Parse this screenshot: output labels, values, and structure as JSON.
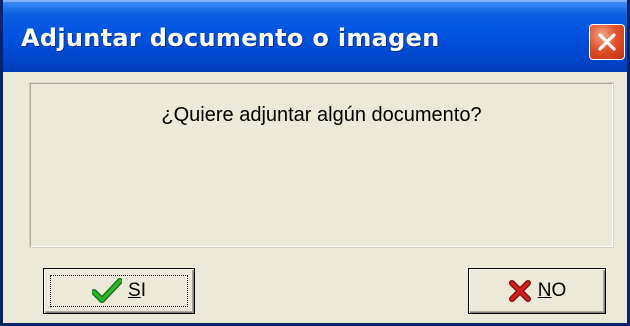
{
  "dialog": {
    "title": "Adjuntar documento o imagen",
    "message": "¿Quiere adjuntar algún documento?",
    "buttons": {
      "yes": {
        "mnemonic": "S",
        "rest": "I"
      },
      "no": {
        "mnemonic": "N",
        "rest": "O"
      }
    }
  },
  "icons": {
    "close": "close-icon",
    "yes": "green-checkmark-icon",
    "no": "red-x-icon"
  },
  "colors": {
    "titlebar": "#0054e3",
    "dialog_bg": "#ece9d8",
    "close_button": "#e0532a",
    "check_green": "#1e9a1e",
    "x_red": "#c81414"
  }
}
